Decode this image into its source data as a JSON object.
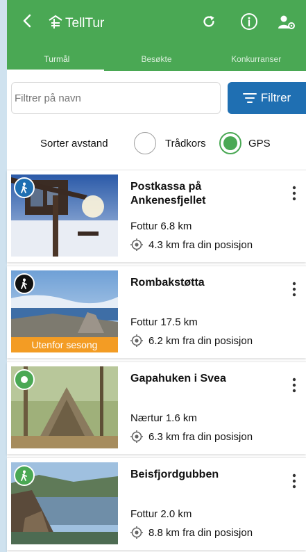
{
  "app": {
    "title": "TellTur"
  },
  "tabs": [
    {
      "label": "Turmål",
      "active": true
    },
    {
      "label": "Besøkte",
      "active": false
    },
    {
      "label": "Konkurranser",
      "active": false
    }
  ],
  "filter": {
    "placeholder": "Filtrer på navn",
    "button_label": "Filtrer"
  },
  "sort": {
    "label": "Sorter avstand",
    "options": [
      "Trådkors",
      "GPS"
    ],
    "selected": "GPS"
  },
  "colors": {
    "brand": "#4aa854",
    "accent_blue": "#1f6fb2",
    "season_badge": "#f39c24"
  },
  "destinations": [
    {
      "name": "Postkassa på Ankenesfjellet",
      "type_distance": "Fottur 6.8 km",
      "distance_from_position": "4.3 km fra din posisjon",
      "badge_icon": "hiker-icon",
      "season_label": ""
    },
    {
      "name": "Rombakstøtta",
      "type_distance": "Fottur 17.5 km",
      "distance_from_position": "6.2 km fra din posisjon",
      "badge_icon": "hiker-icon",
      "season_label": "Utenfor sesong"
    },
    {
      "name": "Gapahuken i Svea",
      "type_distance": "Nærtur 1.6 km",
      "distance_from_position": "6.3 km fra din posisjon",
      "badge_icon": "circle-icon",
      "season_label": ""
    },
    {
      "name": "Beisfjordgubben",
      "type_distance": "Fottur 2.0 km",
      "distance_from_position": "8.8 km fra din posisjon",
      "badge_icon": "hiker-icon",
      "season_label": ""
    }
  ]
}
